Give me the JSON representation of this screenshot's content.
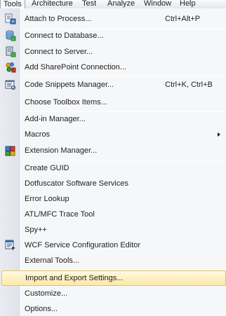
{
  "menubar": {
    "items": [
      {
        "label": "Tools",
        "active": true
      },
      {
        "label": "Architecture"
      },
      {
        "label": "Test"
      },
      {
        "label": "Analyze"
      },
      {
        "label": "Window"
      },
      {
        "label": "Help"
      }
    ]
  },
  "menu": {
    "attach": {
      "label": "Attach to Process...",
      "shortcut": "Ctrl+Alt+P",
      "icon": "attach-process-icon"
    },
    "connect_db": {
      "label": "Connect to Database...",
      "icon": "database-icon"
    },
    "connect_server": {
      "label": "Connect to Server...",
      "icon": "server-icon"
    },
    "sharepoint": {
      "label": "Add SharePoint Connection...",
      "icon": "sharepoint-icon"
    },
    "snippets": {
      "label": "Code Snippets Manager...",
      "shortcut": "Ctrl+K, Ctrl+B",
      "icon": "code-snippets-icon"
    },
    "toolbox": {
      "label": "Choose Toolbox Items..."
    },
    "addin": {
      "label": "Add-in Manager..."
    },
    "macros": {
      "label": "Macros"
    },
    "extension": {
      "label": "Extension Manager...",
      "icon": "extension-manager-icon"
    },
    "guid": {
      "label": "Create GUID"
    },
    "dotfuscator": {
      "label": "Dotfuscator Software Services"
    },
    "error_lookup": {
      "label": "Error Lookup"
    },
    "atl_trace": {
      "label": "ATL/MFC Trace Tool"
    },
    "spy": {
      "label": "Spy++"
    },
    "wcf": {
      "label": "WCF Service Configuration Editor",
      "icon": "wcf-config-icon"
    },
    "external": {
      "label": "External Tools..."
    },
    "import_export": {
      "label": "Import and Export Settings...",
      "highlighted": true
    },
    "customize": {
      "label": "Customize..."
    },
    "options": {
      "label": "Options..."
    }
  },
  "colors": {
    "highlight_top": "#fff9e1",
    "highlight_bottom": "#fde9a7",
    "highlight_border": "#e5c365",
    "menu_bg": "#f6f7f9",
    "gutter": "#e9ecf1"
  }
}
